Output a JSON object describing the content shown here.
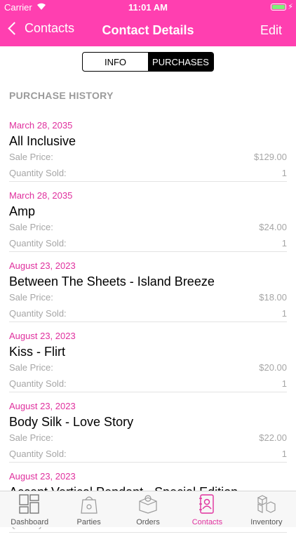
{
  "status_bar": {
    "carrier": "Carrier",
    "time": "11:01 AM"
  },
  "nav": {
    "back_label": "Contacts",
    "title": "Contact Details",
    "edit_label": "Edit"
  },
  "segments": {
    "info": "INFO",
    "purchases": "PURCHASES",
    "selected": "PURCHASES"
  },
  "section_header": "PURCHASE HISTORY",
  "labels": {
    "sale_price": "Sale Price:",
    "quantity_sold": "Quantity Sold:"
  },
  "purchases": [
    {
      "date": "March 28, 2035",
      "name": "All Inclusive",
      "price": "$129.00",
      "qty": "1"
    },
    {
      "date": "March 28, 2035",
      "name": "Amp",
      "price": "$24.00",
      "qty": "1"
    },
    {
      "date": "August 23, 2023",
      "name": "Between The Sheets - Island Breeze",
      "price": "$18.00",
      "qty": "1"
    },
    {
      "date": "August 23, 2023",
      "name": "Kiss - Flirt",
      "price": "$20.00",
      "qty": "1"
    },
    {
      "date": "August 23, 2023",
      "name": "Body Silk - Love Story",
      "price": "$22.00",
      "qty": "1"
    },
    {
      "date": "August 23, 2023",
      "name": "Accent Vertical Pendant - Special Edition",
      "price": "",
      "qty": ""
    }
  ],
  "tabs": [
    {
      "label": "Dashboard",
      "icon": "dashboard-icon"
    },
    {
      "label": "Parties",
      "icon": "parties-icon"
    },
    {
      "label": "Orders",
      "icon": "orders-icon"
    },
    {
      "label": "Contacts",
      "icon": "contacts-icon"
    },
    {
      "label": "Inventory",
      "icon": "inventory-icon"
    }
  ],
  "colors": {
    "accent": "#ff3fb0",
    "date_text": "#e0309e",
    "battery": "#7ef07a"
  }
}
